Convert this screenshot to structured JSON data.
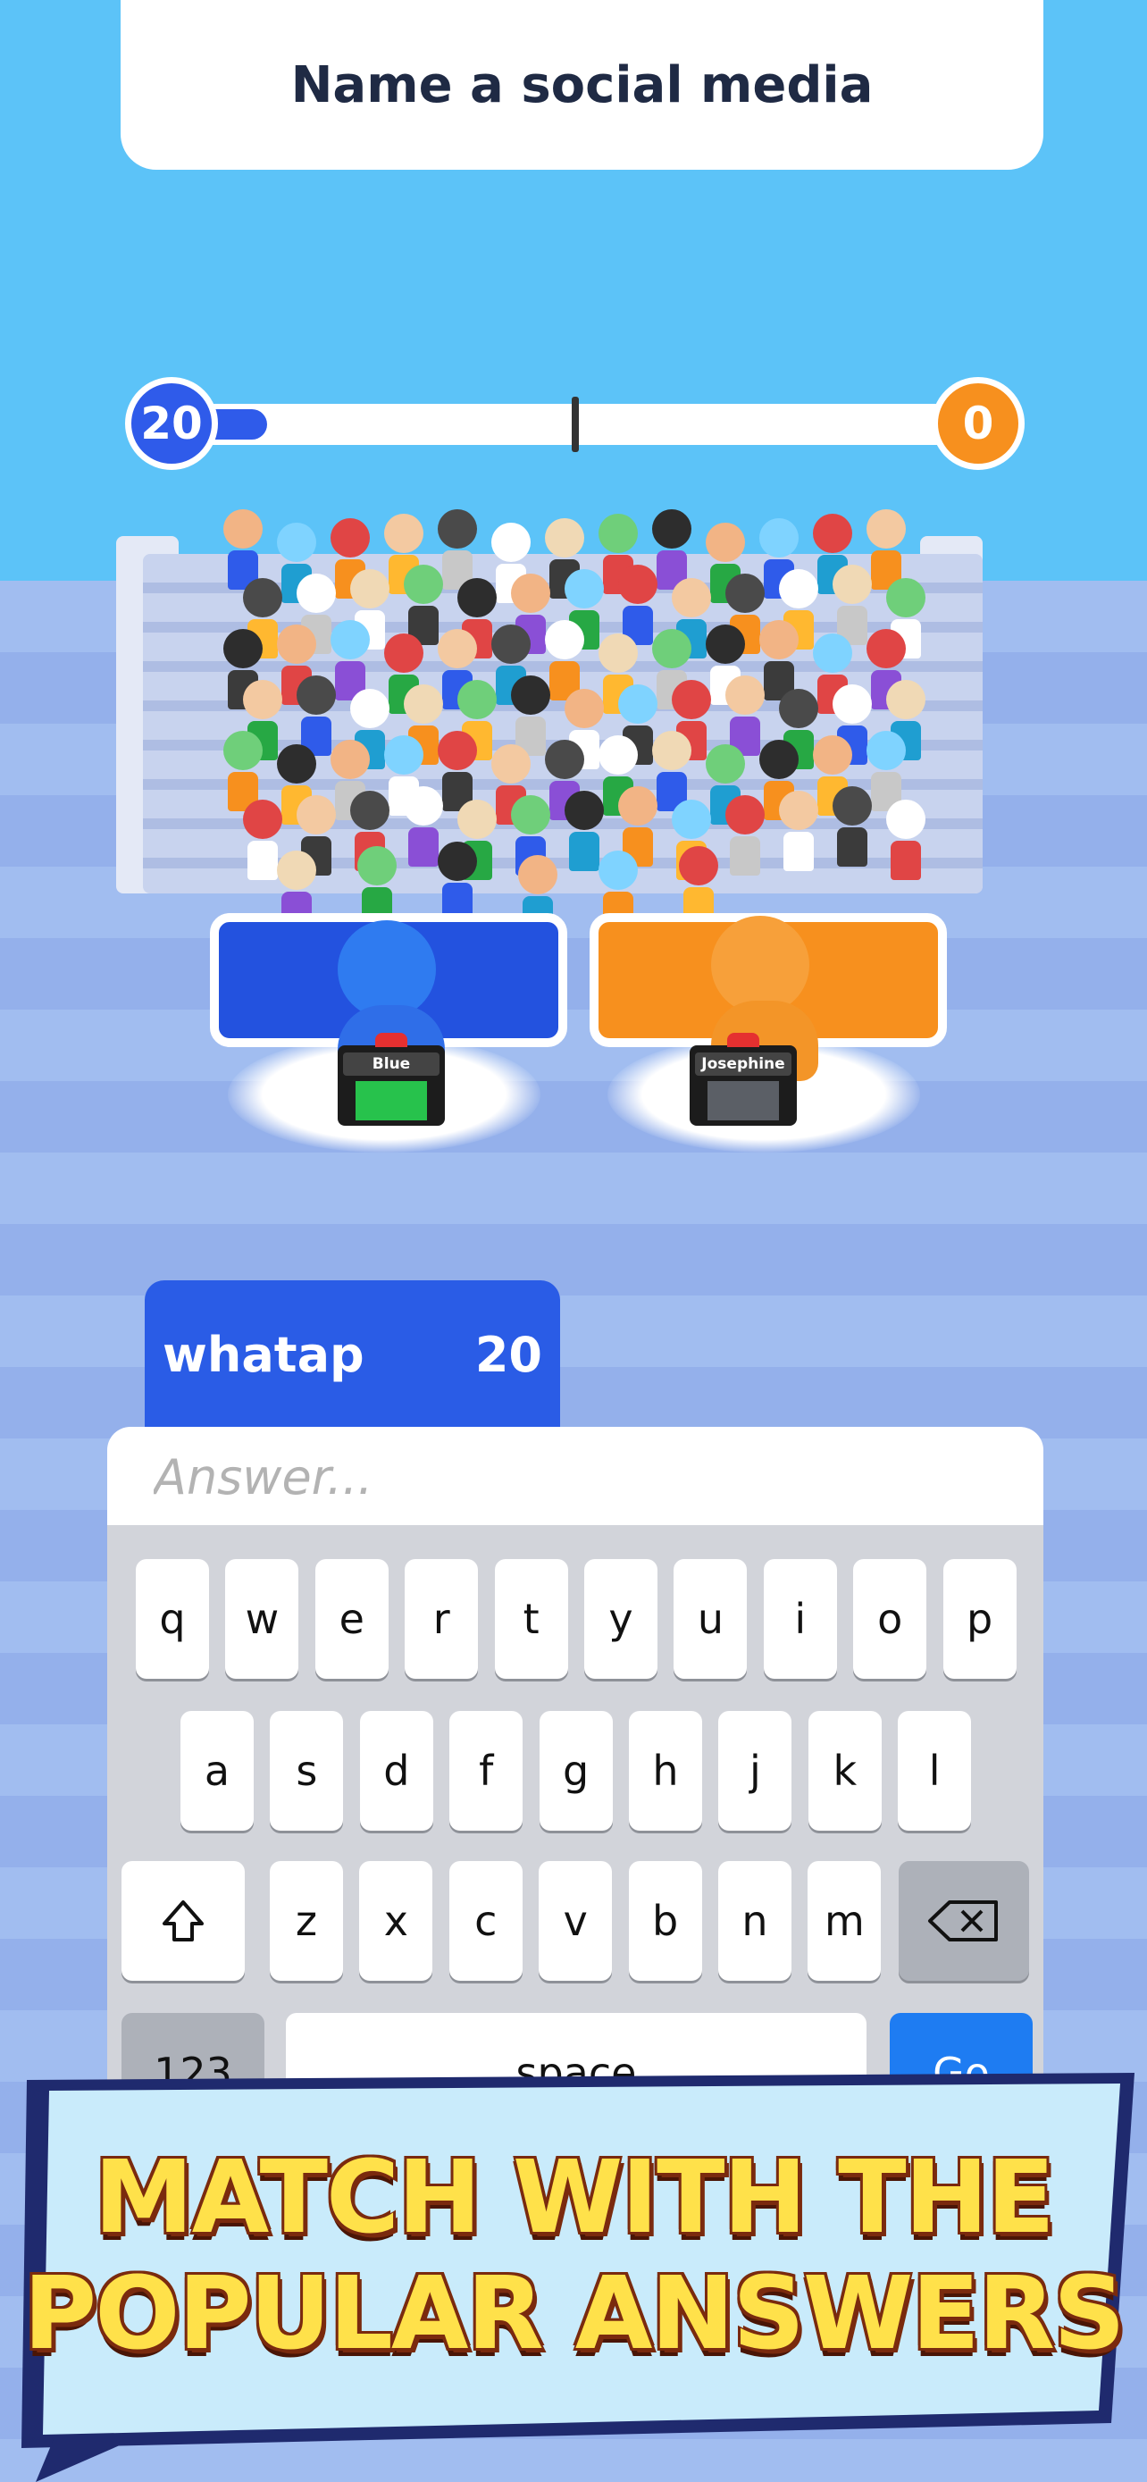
{
  "question": {
    "text": "Name a social media"
  },
  "scoreboard": {
    "left_score": "20",
    "right_score": "0",
    "progress_fraction": 0.16
  },
  "podiums": {
    "left_name": "Blue",
    "right_name": "Josephine"
  },
  "answer_card": {
    "word": "whatap",
    "points": "20"
  },
  "input": {
    "placeholder": "Answer..."
  },
  "keyboard": {
    "row1": [
      "q",
      "w",
      "e",
      "r",
      "t",
      "y",
      "u",
      "i",
      "o",
      "p"
    ],
    "row2": [
      "a",
      "s",
      "d",
      "f",
      "g",
      "h",
      "j",
      "k",
      "l"
    ],
    "row3": [
      "z",
      "x",
      "c",
      "v",
      "b",
      "n",
      "m"
    ],
    "shift_icon": "shift-arrow-icon",
    "backspace_icon": "backspace-icon",
    "numbers_label": "123",
    "space_label": "space",
    "go_label": "Go"
  },
  "banner": {
    "line1": "MATCH WITH THE",
    "line2": "POPULAR ANSWERS"
  },
  "colors": {
    "team_blue": "#2f5bea",
    "team_orange": "#f7901e",
    "banner_yellow": "#ffe14a"
  }
}
